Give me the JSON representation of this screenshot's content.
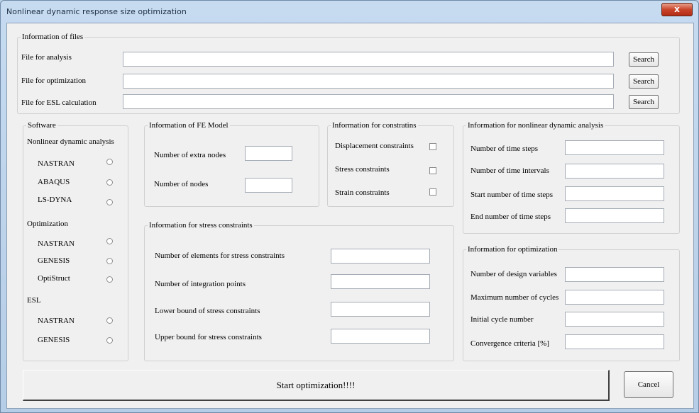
{
  "window": {
    "title": "Nonlinear dynamic response size optimization",
    "close_label": "x"
  },
  "files": {
    "legend": "Information of files",
    "rows": [
      {
        "label": "File for analysis",
        "value": "",
        "button": "Search"
      },
      {
        "label": "File for optimization",
        "value": "",
        "button": "Search"
      },
      {
        "label": "File for ESL calculation",
        "value": "",
        "button": "Search"
      }
    ]
  },
  "software": {
    "legend": "Software",
    "nonlinear": {
      "heading": "Nonlinear dynamic analysis",
      "options": [
        "NASTRAN",
        "ABAQUS",
        "LS-DYNA"
      ]
    },
    "optimization": {
      "heading": "Optimization",
      "options": [
        "NASTRAN",
        "GENESIS",
        "OptiStruct"
      ]
    },
    "esl": {
      "heading": "ESL",
      "options": [
        "NASTRAN",
        "GENESIS"
      ]
    }
  },
  "fe_model": {
    "legend": "Information of FE Model",
    "extra_nodes_label": "Number of extra nodes",
    "extra_nodes_value": "",
    "nodes_label": "Number of nodes",
    "nodes_value": ""
  },
  "constraints": {
    "legend": "Information for constratins",
    "items": [
      "Displacement constraints",
      "Stress constraints",
      "Strain constraints"
    ]
  },
  "stress": {
    "legend": "Information for stress constraints",
    "rows": [
      {
        "label": "Number of elements for stress constraints",
        "value": ""
      },
      {
        "label": "Number of integration points",
        "value": ""
      },
      {
        "label": "Lower bound of stress constraints",
        "value": ""
      },
      {
        "label": "Upper bound for stress constraints",
        "value": ""
      }
    ]
  },
  "nonlinear_analysis": {
    "legend": "Information for nonlinear dynamic analysis",
    "rows": [
      {
        "label": "Number of time steps",
        "value": ""
      },
      {
        "label": "Number of time intervals",
        "value": ""
      },
      {
        "label": "Start number of time steps",
        "value": ""
      },
      {
        "label": "End number of time steps",
        "value": ""
      }
    ]
  },
  "optimization_info": {
    "legend": "Information for optimization",
    "rows": [
      {
        "label": "Number of design variables",
        "value": ""
      },
      {
        "label": "Maximum number of cycles",
        "value": ""
      },
      {
        "label": "Initial cycle number",
        "value": ""
      },
      {
        "label": "Convergence criteria [%]",
        "value": ""
      }
    ]
  },
  "actions": {
    "start_label": "Start optimization!!!!",
    "cancel_label": "Cancel"
  }
}
